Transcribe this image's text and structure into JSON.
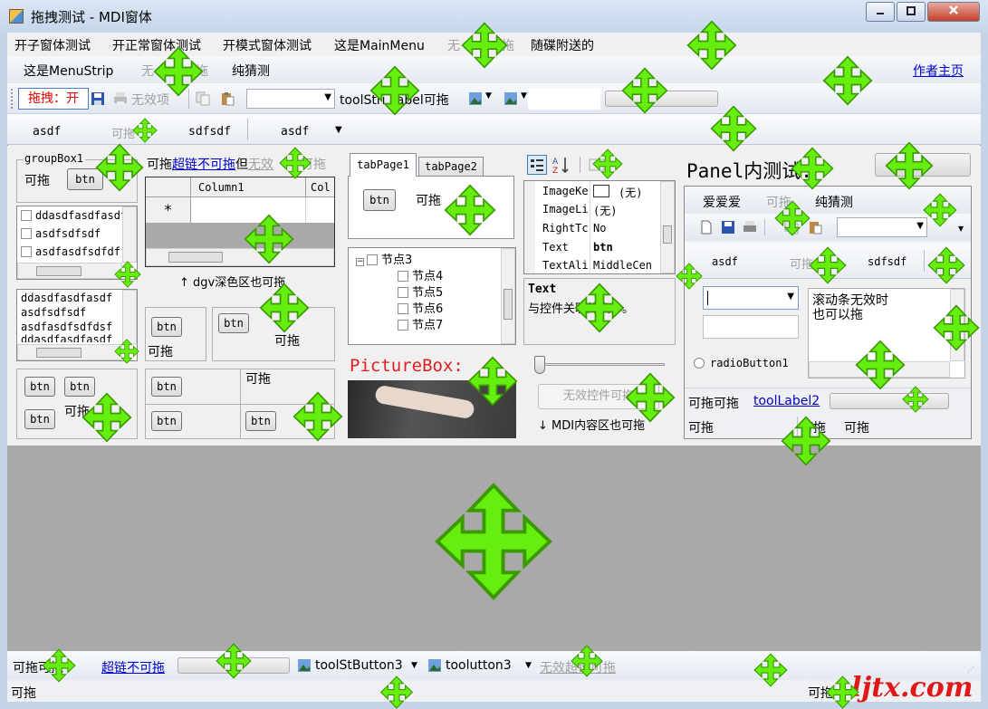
{
  "window": {
    "title": "拖拽测试 - MDI窗体",
    "minimize": "0",
    "maximize": "1",
    "close": "r"
  },
  "main_menu": {
    "items": [
      "开子窗体测试",
      "开正常窗体测试",
      "开模式窗体测试",
      "这是MainMenu",
      "无",
      "拖",
      "随碟附送的"
    ]
  },
  "menu_strip": {
    "items": [
      "这是MenuStrip",
      "无",
      "拖",
      "纯猜测"
    ],
    "author_link": "作者主页"
  },
  "toolstrip": {
    "drag_toggle": "拖拽：开",
    "disabled_item": "无效项",
    "label": "toolStrip Label可拖",
    "label_text": "toolStri",
    "label_text2": "Label可拖"
  },
  "tabstrip": {
    "tab1": "asdf",
    "tab2": "可拖",
    "tab3": "sdfsdf",
    "tab4": "asdf"
  },
  "groupbox": {
    "title": "groupBox1",
    "label": "可拖",
    "button": "btn"
  },
  "top_link_row": {
    "label1": "可拖",
    "link": "超链不可拖",
    "label2": "但",
    "disabled": "无效",
    "label3": "可拖"
  },
  "checked_list": {
    "items": [
      "ddasdfasdfasdf",
      "asdfsdfsdf",
      "asdfasdfsdfdf"
    ]
  },
  "listbox": {
    "items": [
      "ddasdfasdfasdf",
      "asdfsdfsdf",
      "asdfasdfsdfdsf",
      "ddasdfasdfasdf"
    ]
  },
  "datagrid": {
    "columns": [
      "Column1",
      "Col"
    ],
    "new_row_marker": "*",
    "caption": "↑ dgv深色区也可拖"
  },
  "small_panels": {
    "btn": "btn",
    "label": "可拖"
  },
  "tabcontrol": {
    "tabs": [
      "tabPage1",
      "tabPage2"
    ],
    "button": "btn",
    "label": "可拖"
  },
  "treeview": {
    "root": "节点3",
    "children": [
      "节点4",
      "节点5",
      "节点6",
      "节点7"
    ]
  },
  "picturebox": {
    "title": "PictureBox:"
  },
  "propertygrid": {
    "rows": [
      {
        "name": "ImageKe",
        "value": "(无)"
      },
      {
        "name": "ImageLi",
        "value": "(无)"
      },
      {
        "name": "RightTc",
        "value": "No"
      },
      {
        "name": "Text",
        "value": "btn"
      },
      {
        "name": "TextAli",
        "value": "MiddleCen"
      }
    ],
    "desc_title": "Text",
    "desc_body": "与控件关联的文本。"
  },
  "trackbar": {
    "value": 0
  },
  "disabled_button": "无效控件可拖",
  "mdi_caption": "↓ MDI内容区也可拖",
  "right_panel": {
    "title": "Panel内测试:",
    "menu": [
      "爱爱爱",
      "可拖",
      "纯猜测"
    ],
    "tabs": [
      "asdf",
      "可拖",
      "sdfsdf"
    ],
    "textarea": "滚动条无效时\n也可以拖",
    "textarea_line1": "滚动条无效时",
    "textarea_line2": "也可以拖",
    "radio": "radioButton1",
    "status_label1": "可拖可拖",
    "status_link": "toolLabel2",
    "status_bottom": [
      "可拖",
      "可拖",
      "可拖"
    ]
  },
  "bottom_toolstrip": {
    "label1": "可拖可拖",
    "link": "超链不可拖",
    "button3": "toolStButton3",
    "button4": "toolutton3",
    "disabled": "无效超链可拖"
  },
  "status": {
    "left": "可拖",
    "right": "可拖"
  },
  "watermark": "ljtx.com",
  "colors": {
    "accent_red": "#e00000",
    "link_blue": "#0000cc",
    "move_green": "#66ee11",
    "mdi_gray": "#a9a9a9"
  }
}
